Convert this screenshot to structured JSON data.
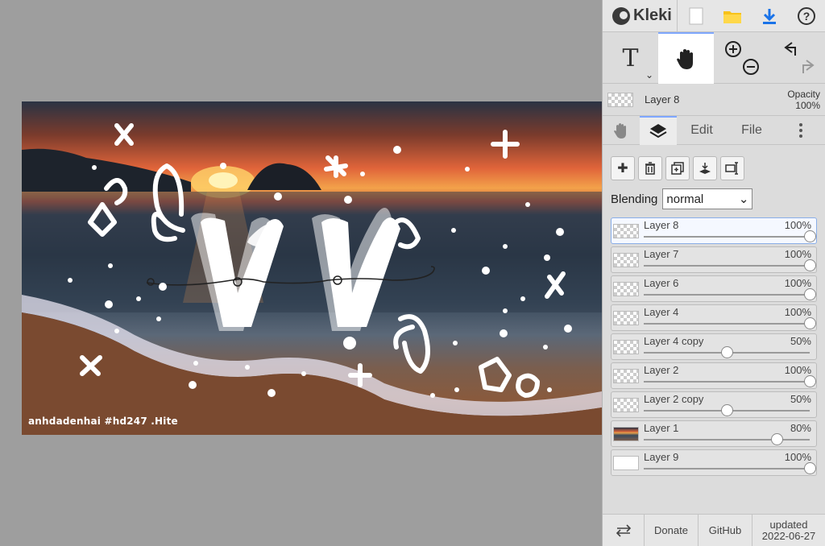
{
  "app": {
    "name": "Kleki"
  },
  "topbar": {
    "icons": [
      "kleki-logo-icon",
      "new-image-icon",
      "open-folder-icon",
      "download-icon",
      "help-icon"
    ]
  },
  "tools": {
    "text_label": "T",
    "active_tool": "hand"
  },
  "current_layer": {
    "name": "Layer 8",
    "opacity_label": "Opacity",
    "opacity_value": "100%"
  },
  "tabs": {
    "edit": "Edit",
    "file": "File"
  },
  "blending": {
    "label": "Blending",
    "value": "normal"
  },
  "layers": [
    {
      "name": "Layer 8",
      "opacity": "100%",
      "value": 1.0,
      "thumb": "checker",
      "selected": true
    },
    {
      "name": "Layer 7",
      "opacity": "100%",
      "value": 1.0,
      "thumb": "checker"
    },
    {
      "name": "Layer 6",
      "opacity": "100%",
      "value": 1.0,
      "thumb": "checker"
    },
    {
      "name": "Layer 4",
      "opacity": "100%",
      "value": 1.0,
      "thumb": "checker"
    },
    {
      "name": "Layer 4 copy",
      "opacity": "50%",
      "value": 0.5,
      "thumb": "checker"
    },
    {
      "name": "Layer 2",
      "opacity": "100%",
      "value": 1.0,
      "thumb": "checker"
    },
    {
      "name": "Layer 2 copy",
      "opacity": "50%",
      "value": 0.5,
      "thumb": "checker"
    },
    {
      "name": "Layer 1",
      "opacity": "80%",
      "value": 0.8,
      "thumb": "photo"
    },
    {
      "name": "Layer 9",
      "opacity": "100%",
      "value": 1.0,
      "thumb": "white"
    }
  ],
  "footer": {
    "donate": "Donate",
    "github": "GitHub",
    "updated_label": "updated",
    "updated_date": "2022-06-27"
  },
  "canvas": {
    "watermark": "anhdadenhai #hd247 .Hite"
  },
  "colors": {
    "accent": "#7fa7ff",
    "download": "#1a73e8",
    "folder": "#f7c21a"
  }
}
